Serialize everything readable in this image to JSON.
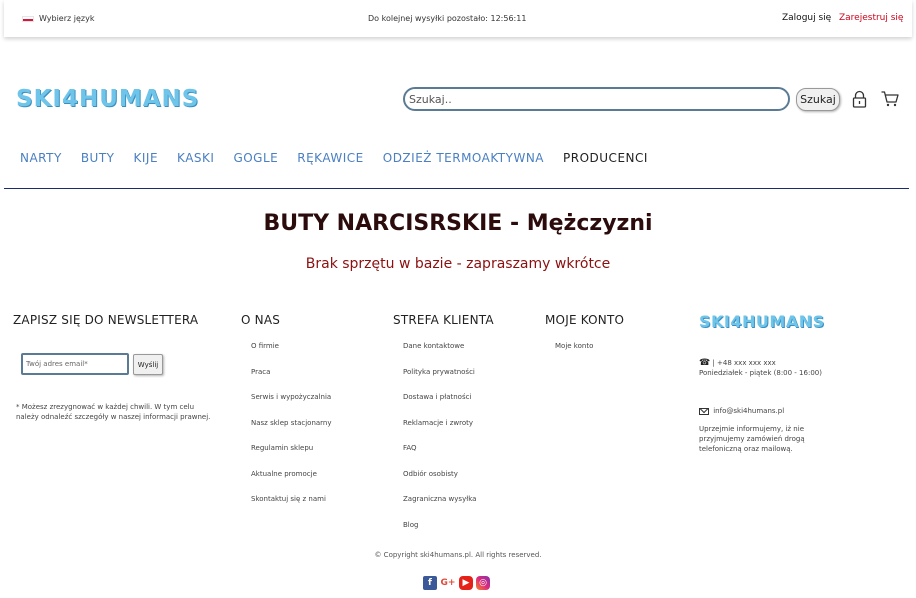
{
  "topbar": {
    "language_label": "Wybierz język",
    "countdown": "Do kolejnej wysyłki pozostało: 12:56:11",
    "login": "Zaloguj się",
    "register": "Zarejestruj się"
  },
  "header": {
    "logo": "SKI4HUMANS",
    "search_placeholder": "Szukaj..",
    "search_button": "Szukaj"
  },
  "nav": {
    "items": [
      "NARTY",
      "BUTY",
      "KIJE",
      "KASKI",
      "GOGLE",
      "RĘKAWICE",
      "ODZIEŻ TERMOAKTYWNA",
      "PRODUCENCI"
    ]
  },
  "main": {
    "title": "BUTY NARCISRSKIE - Mężczyzni",
    "empty_message": "Brak sprzętu w bazie - zapraszamy wkrótce"
  },
  "footer": {
    "newsletter": {
      "heading": "ZAPISZ SIĘ DO NEWSLETTERA",
      "placeholder": "Twój adres email*",
      "button": "Wyślij",
      "note": "* Możesz zrezygnować w każdej chwili. W tym celu należy odnaleźć szczegóły w naszej informacji prawnej."
    },
    "about": {
      "heading": "O NAS",
      "links": [
        "O firmie",
        "Praca",
        "Serwis i wypożyczalnia",
        "Nasz sklep stacjonarny",
        "Regulamin sklepu",
        "Aktualne promocje",
        "Skontaktuj się z nami"
      ]
    },
    "client": {
      "heading": "STREFA KLIENTA",
      "links": [
        "Dane kontaktowe",
        "Polityka prywatności",
        "Dostawa i płatności",
        "Reklamacje i zwroty",
        "FAQ",
        "Odbiór osobisty",
        "Zagraniczna wysyłka",
        "Blog"
      ]
    },
    "account": {
      "heading": "MOJE KONTO",
      "links": [
        "Moje konto"
      ]
    },
    "contact": {
      "logo": "SKI4HUMANS",
      "phone": "| +48 xxx xxx xxx",
      "hours": "Poniedziałek - piątek (8:00 - 16:00)",
      "email": "info@ski4humans.pl",
      "notice": "Uprzejmie informujemy, iż nie przyjmujemy zamówień drogą telefoniczną oraz mailową."
    },
    "copyright": "© Copyright ski4humans.pl. All rights reserved.",
    "social_icons": [
      "facebook-icon",
      "google-plus-icon",
      "youtube-icon",
      "instagram-icon"
    ]
  }
}
